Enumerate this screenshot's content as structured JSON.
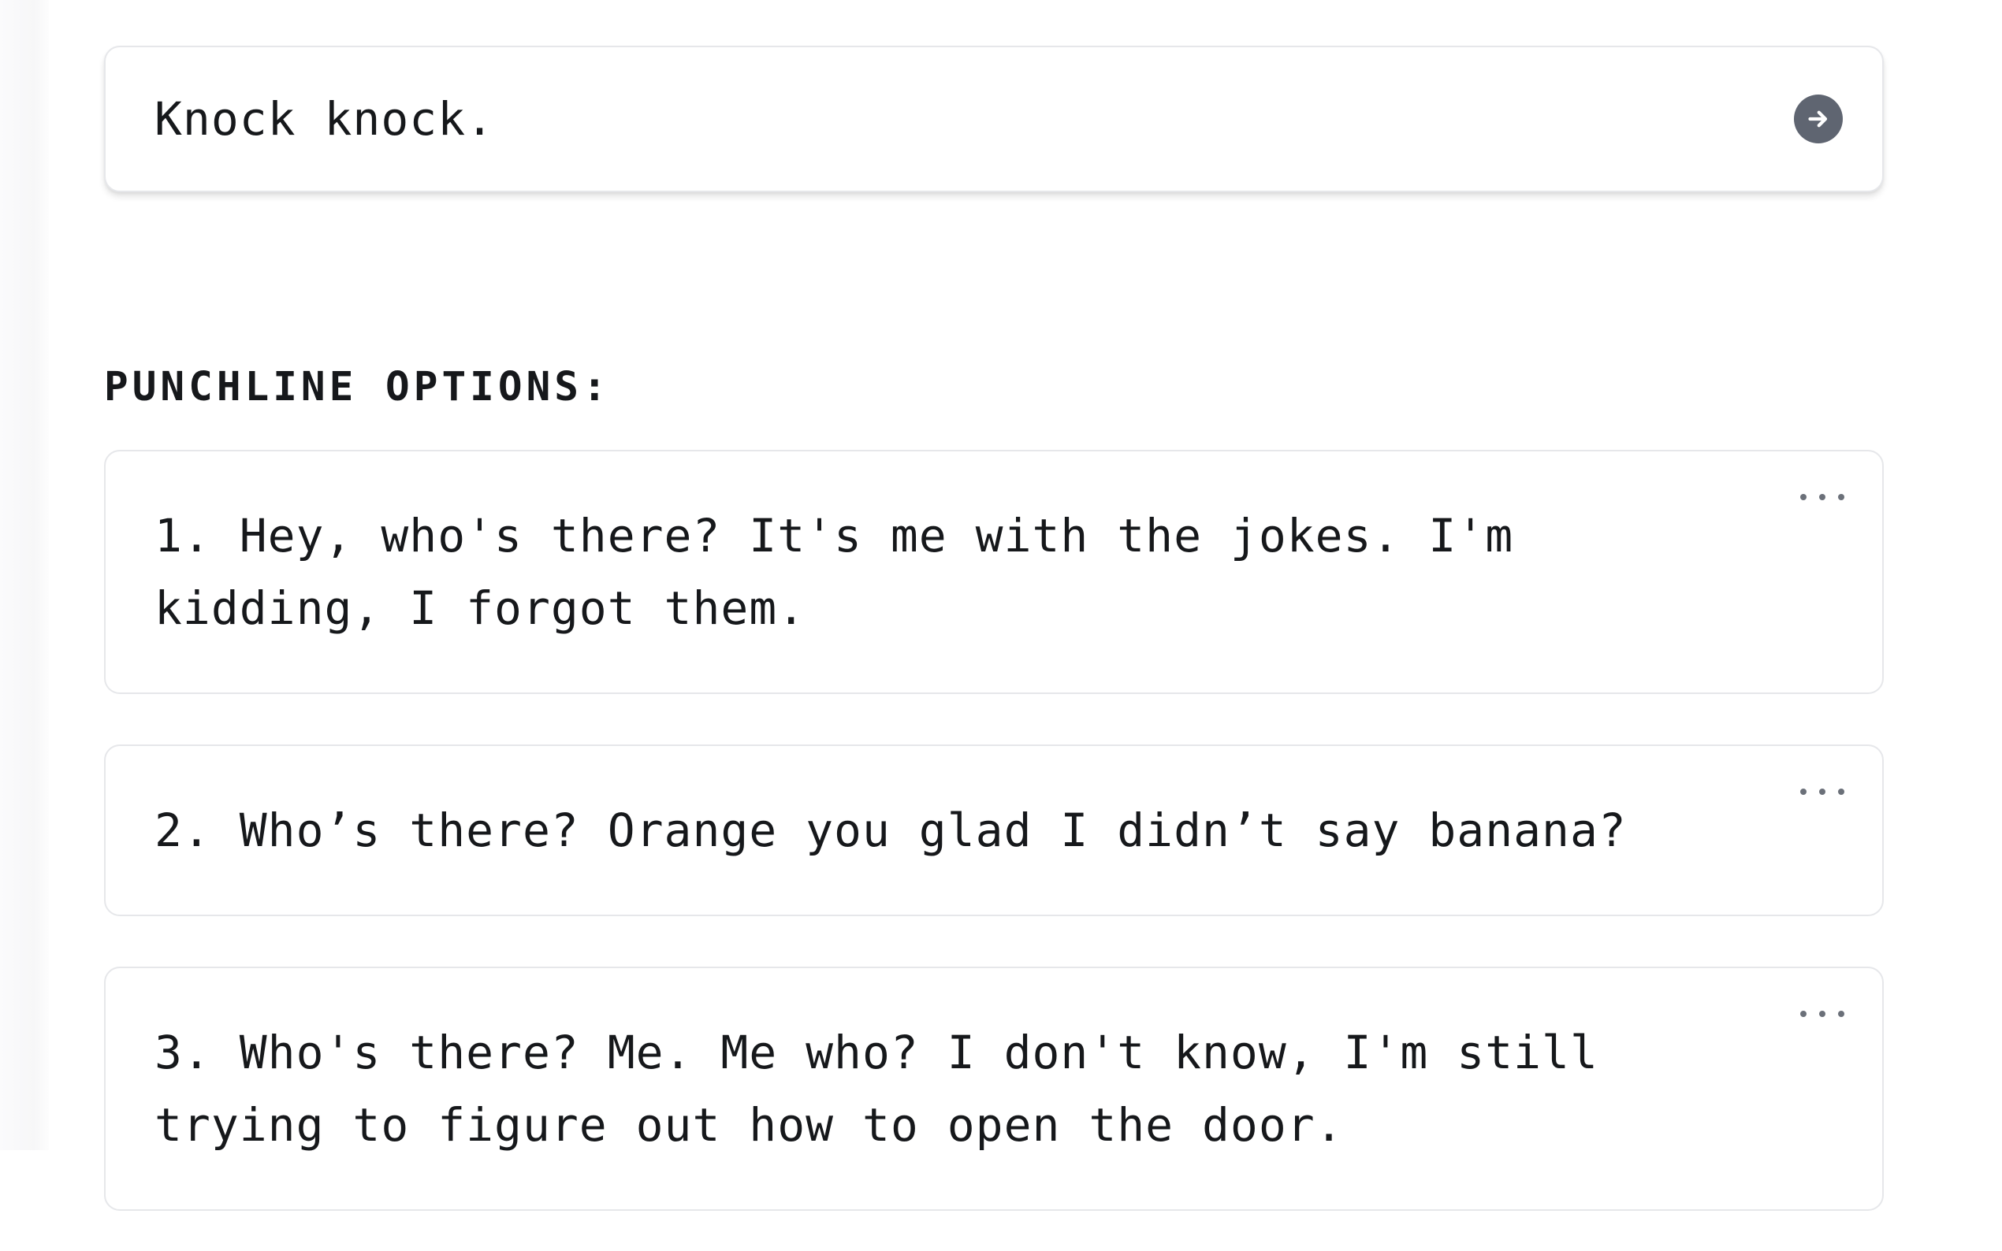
{
  "prompt": {
    "text": "Knock knock.",
    "submit_icon": "arrow-right-icon"
  },
  "punchlines": {
    "heading": "PUNCHLINE OPTIONS:",
    "options": [
      {
        "text": "1. Hey, who's there? It's me with the jokes. I'm kidding, I forgot them.",
        "menu_icon": "more-horizontal-icon"
      },
      {
        "text": "2. Who’s there? Orange you glad I didn’t say banana?",
        "menu_icon": "more-horizontal-icon"
      },
      {
        "text": "3. Who's there? Me. Me who? I don't know, I'm still trying to figure out how to open the door.",
        "menu_icon": "more-horizontal-icon"
      }
    ]
  },
  "colors": {
    "text": "#16181b",
    "border": "#e6e7ea",
    "submit_button": "#5f6571",
    "menu_dots": "#6b7079"
  }
}
